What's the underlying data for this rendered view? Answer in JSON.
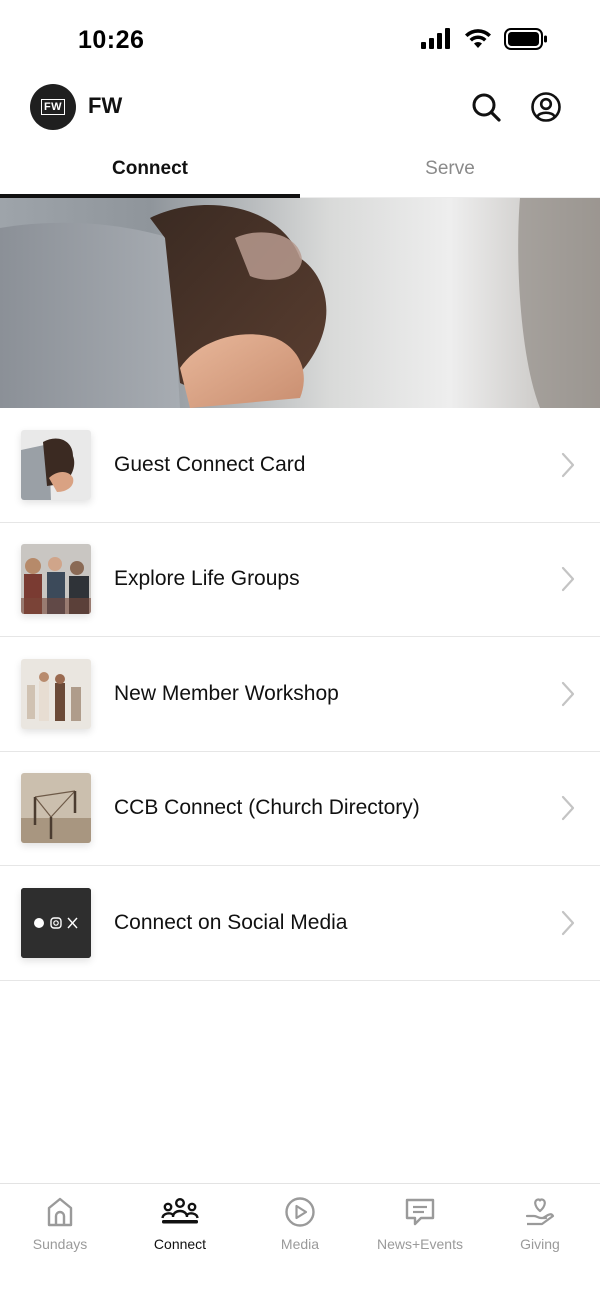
{
  "status_bar": {
    "time": "10:26"
  },
  "header": {
    "brand_logo_text": "FW",
    "brand_name": "FW"
  },
  "tabs": [
    {
      "label": "Connect",
      "active": true
    },
    {
      "label": "Serve",
      "active": false
    }
  ],
  "list_items": [
    {
      "label": "Guest Connect Card",
      "thumb": "handshake"
    },
    {
      "label": "Explore Life Groups",
      "thumb": "group-of-people"
    },
    {
      "label": "New Member Workshop",
      "thumb": "people-walking"
    },
    {
      "label": "CCB Connect (Church Directory)",
      "thumb": "pins-network"
    },
    {
      "label": "Connect on Social Media",
      "thumb": "social-icons"
    }
  ],
  "bottom_nav": [
    {
      "label": "Sundays",
      "icon": "church-icon",
      "active": false
    },
    {
      "label": "Connect",
      "icon": "people-icon",
      "active": true
    },
    {
      "label": "Media",
      "icon": "play-icon",
      "active": false
    },
    {
      "label": "News+Events",
      "icon": "chat-icon",
      "active": false
    },
    {
      "label": "Giving",
      "icon": "heart-hand-icon",
      "active": false
    }
  ],
  "colors": {
    "active": "#111111",
    "inactive": "#9a9a9a",
    "divider": "#e6e6e6"
  }
}
